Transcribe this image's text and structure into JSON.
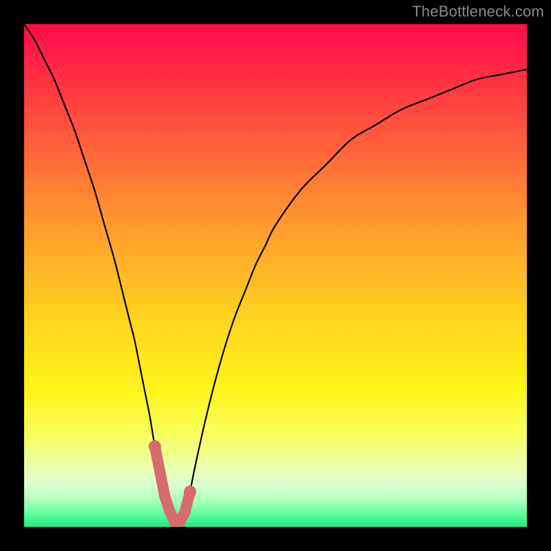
{
  "watermark": "TheBottleneck.com",
  "chart_data": {
    "type": "line",
    "title": "",
    "xlabel": "",
    "ylabel": "",
    "xlim": [
      0,
      100
    ],
    "ylim": [
      0,
      100
    ],
    "x": [
      0,
      2,
      4,
      6,
      8,
      10,
      12,
      14,
      16,
      18,
      20,
      21,
      22,
      23,
      24,
      25,
      26,
      27,
      28,
      29,
      30,
      31,
      32,
      33,
      34,
      36,
      38,
      40,
      42,
      44,
      46,
      48,
      50,
      55,
      60,
      65,
      70,
      75,
      80,
      85,
      90,
      95,
      100
    ],
    "values": [
      100,
      97,
      93,
      89,
      84,
      79,
      73,
      67,
      60,
      53,
      45,
      41,
      37,
      32,
      27,
      22,
      16,
      11,
      6,
      3,
      1,
      1,
      3,
      7,
      12,
      21,
      29,
      36,
      42,
      47,
      52,
      56,
      60,
      67,
      72,
      77,
      80,
      83,
      85,
      87,
      89,
      90,
      91
    ],
    "annotations": {
      "minimum_marker_x_range": [
        26,
        33
      ],
      "minimum_marker_style": "thick-salmon-segment"
    },
    "colors": {
      "curve": "#000000",
      "marker": "#d86b6b",
      "gradient_stops": [
        {
          "pos": 0.0,
          "color": "#ff0a4a"
        },
        {
          "pos": 0.18,
          "color": "#ff4a3e"
        },
        {
          "pos": 0.4,
          "color": "#ff9a2e"
        },
        {
          "pos": 0.58,
          "color": "#ffd21e"
        },
        {
          "pos": 0.73,
          "color": "#fff51a"
        },
        {
          "pos": 0.82,
          "color": "#f7ff60"
        },
        {
          "pos": 0.88,
          "color": "#ecffb0"
        },
        {
          "pos": 0.92,
          "color": "#d7ffd0"
        },
        {
          "pos": 0.95,
          "color": "#a4ffb9"
        },
        {
          "pos": 0.975,
          "color": "#5bff9c"
        },
        {
          "pos": 1.0,
          "color": "#1de884"
        }
      ]
    }
  }
}
